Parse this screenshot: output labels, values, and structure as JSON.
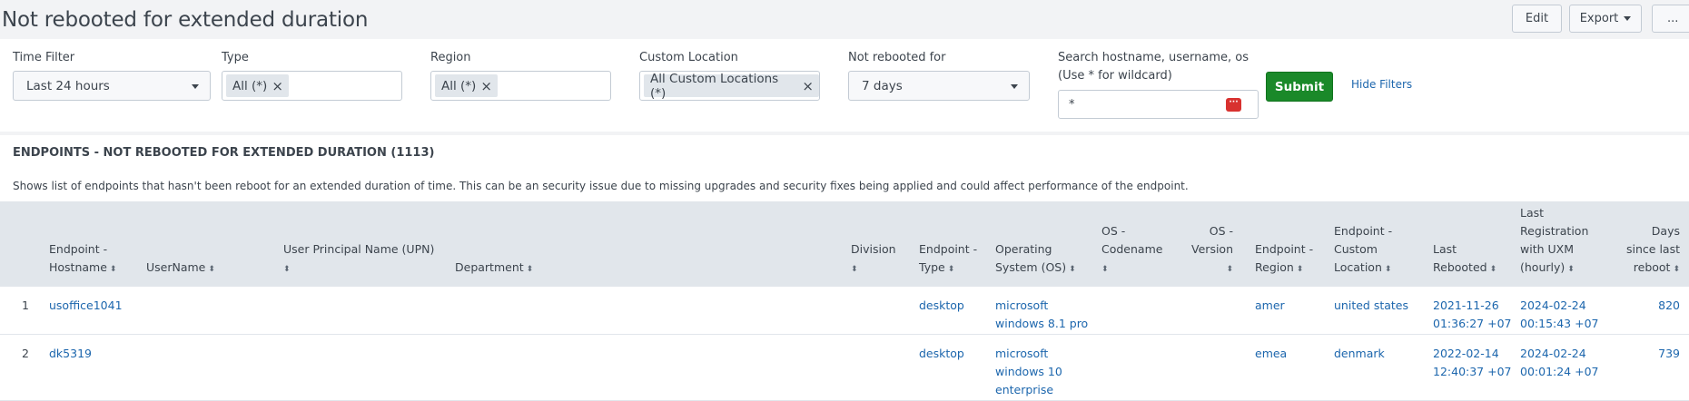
{
  "header": {
    "title": "Not rebooted for extended duration",
    "edit_label": "Edit",
    "export_label": "Export",
    "more_label": "..."
  },
  "filters": {
    "time": {
      "label": "Time Filter",
      "value": "Last 24 hours"
    },
    "type": {
      "label": "Type",
      "chip": "All (*)"
    },
    "region": {
      "label": "Region",
      "chip": "All (*)"
    },
    "custom_location": {
      "label": "Custom Location",
      "chip": "All Custom Locations (*)"
    },
    "not_rebooted": {
      "label": "Not rebooted for",
      "value": "7 days"
    },
    "search": {
      "label_line1": "Search hostname, username, os",
      "label_line2": "(Use * for wildcard)",
      "value": "*"
    },
    "submit_label": "Submit",
    "hide_filters_label": "Hide Filters"
  },
  "panel": {
    "title": "ENDPOINTS - NOT REBOOTED FOR EXTENDED DURATION (1113)",
    "description": "Shows list of endpoints that hasn't been reboot for an extended duration of time. This can be an security issue due to missing upgrades and security fixes being applied and could affect performance of the endpoint."
  },
  "table": {
    "columns": {
      "hostname": [
        "Endpoint -",
        "Hostname"
      ],
      "username": [
        "UserName"
      ],
      "upn": [
        "User Principal Name (UPN)"
      ],
      "department": [
        "Department"
      ],
      "division": [
        "Division"
      ],
      "type": [
        "Endpoint -",
        "Type"
      ],
      "os": [
        "Operating",
        "System (OS)"
      ],
      "codename": [
        "OS -",
        "Codename"
      ],
      "version": [
        "OS -",
        "Version"
      ],
      "region": [
        "Endpoint -",
        "Region"
      ],
      "location": [
        "Endpoint -",
        "Custom",
        "Location"
      ],
      "last_rebooted": [
        "Last",
        "Rebooted"
      ],
      "last_registration": [
        "Last",
        "Registration",
        "with UXM",
        "(hourly)"
      ],
      "days": [
        "Days",
        "since last",
        "reboot"
      ]
    },
    "rows": [
      {
        "index": "1",
        "hostname": "usoffice1041",
        "type": "desktop",
        "os": [
          "microsoft",
          "windows 8.1 pro"
        ],
        "region": "amer",
        "location": "united states",
        "last_rebooted": [
          "2021-11-26",
          "01:36:27 +07"
        ],
        "last_registration": [
          "2024-02-24",
          "00:15:43 +07"
        ],
        "days": "820"
      },
      {
        "index": "2",
        "hostname": "dk5319",
        "type": "desktop",
        "os": [
          "microsoft",
          "windows 10",
          "enterprise"
        ],
        "region": "emea",
        "location": "denmark",
        "last_rebooted": [
          "2022-02-14",
          "12:40:37 +07"
        ],
        "last_registration": [
          "2024-02-24",
          "00:01:24 +07"
        ],
        "days": "739"
      }
    ]
  }
}
